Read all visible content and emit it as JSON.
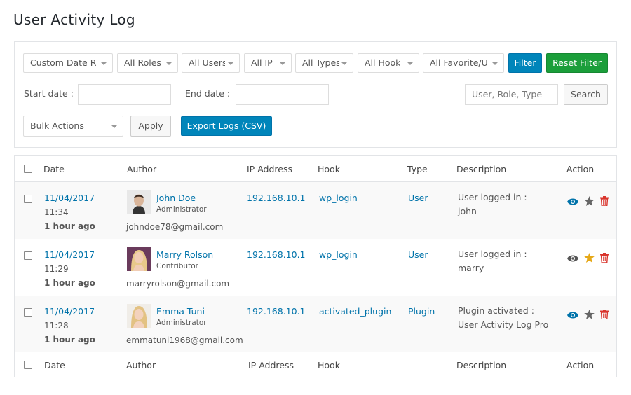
{
  "page": {
    "title": "User Activity Log"
  },
  "filters": {
    "date": "Custom Date R",
    "roles": "All Roles",
    "users": "All Users",
    "ip": "All IP",
    "types": "All Types",
    "hook": "All Hook",
    "favorite": "All Favorite/U",
    "filter_btn": "Filter",
    "reset_btn": "Reset Filter",
    "start_label": "Start date :",
    "end_label": "End date :",
    "search_placeholder": "User, Role, Type",
    "search_btn": "Search",
    "bulk": "Bulk Actions",
    "apply_btn": "Apply",
    "export_btn": "Export Logs (CSV)"
  },
  "table": {
    "headers": {
      "date": "Date",
      "author": "Author",
      "ip": "IP Address",
      "hook": "Hook",
      "type": "Type",
      "description": "Description",
      "action": "Action"
    },
    "footers": {
      "date": "Date",
      "author": "Author",
      "ip": "IP Address",
      "hook": "Hook",
      "description": "Description",
      "action": "Action"
    },
    "rows": [
      {
        "date": "11/04/2017",
        "time": "11:34",
        "ago": "1 hour ago",
        "name": "John Doe",
        "role": "Administrator",
        "email": "johndoe78@gmail.com",
        "ip": "192.168.10.1",
        "hook": "wp_login",
        "type": "User",
        "desc1": "User logged in :",
        "desc2": "john",
        "eye_color": "#0073aa",
        "star_color": "#666666"
      },
      {
        "date": "11/04/2017",
        "time": "11:29",
        "ago": "1 hour ago",
        "name": "Marry Rolson",
        "role": "Contributor",
        "email": "marryrolson@gmail.com",
        "ip": "192.168.10.1",
        "hook": "wp_login",
        "type": "User",
        "desc1": "User logged in :",
        "desc2": "marry",
        "eye_color": "#555555",
        "star_color": "#e6a817"
      },
      {
        "date": "11/04/2017",
        "time": "11:28",
        "ago": "1 hour ago",
        "name": "Emma Tuni",
        "role": "Administrator",
        "email": "emmatuni1968@gmail.com",
        "ip": "192.168.10.1",
        "hook": "activated_plugin",
        "type": "Plugin",
        "desc1": "Plugin activated :",
        "desc2": "User Activity Log Pro",
        "eye_color": "#0073aa",
        "star_color": "#666666"
      }
    ]
  },
  "colors": {
    "link": "#0073aa",
    "filter": "#0085ba",
    "reset": "#1b9e3a",
    "delete": "#d9352d"
  }
}
